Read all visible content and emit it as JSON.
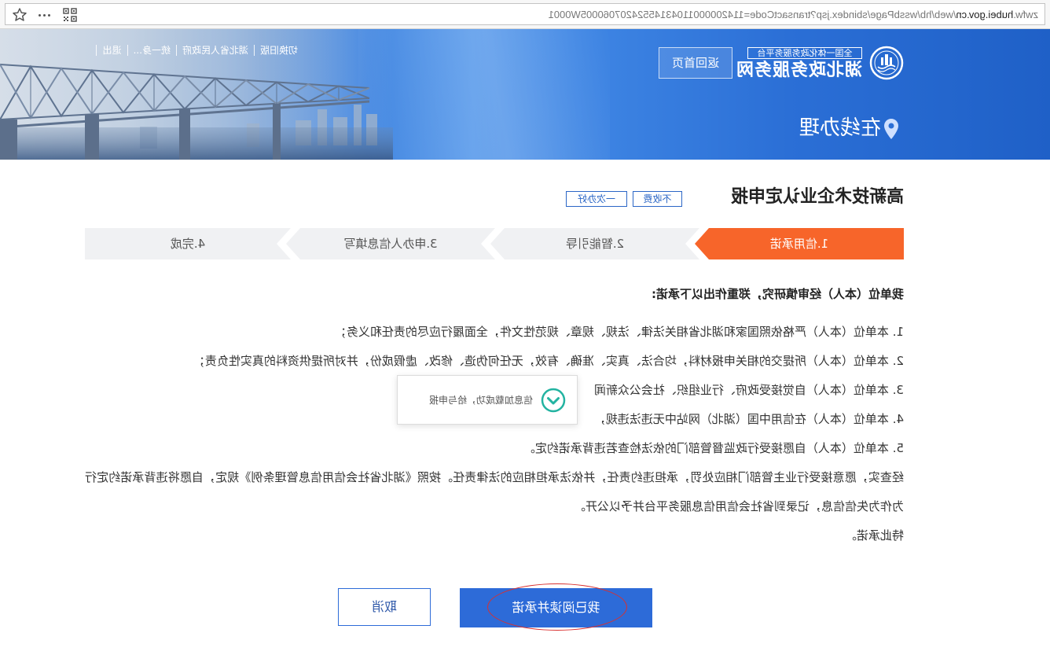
{
  "browser": {
    "url_prefix": "zwfw.",
    "url_domain": "hubei.gov.cn",
    "url_path": "/web/hb/wssbPage/sbindex.jsp?transactCode=11420000011043145524207060005W0001",
    "icons": {
      "qr": "qr-code-icon",
      "more": "more-icon",
      "star": "star-icon"
    }
  },
  "header": {
    "logo_subtitle": "全国一体化政务服务平台",
    "logo_title": "湖北政务服务网",
    "home_button": "返回首页",
    "top_links": [
      "切换旧版",
      "湖北省人民政府",
      "统一身...",
      "退出"
    ],
    "section_title": "在线办理",
    "icons": {
      "emblem": "emblem-icon",
      "location": "location-pin-icon"
    }
  },
  "service": {
    "title": "高新技术企业认定申报",
    "tags": [
      "不收费",
      "一次办好"
    ]
  },
  "steps": [
    {
      "label": "1.信用承诺",
      "active": true
    },
    {
      "label": "2.智能引导",
      "active": false
    },
    {
      "label": "3.申办人信息填写",
      "active": false
    },
    {
      "label": "4.完成",
      "active": false
    }
  ],
  "promise": {
    "heading": "我单位（本人）经审慎研究，郑重作出以下承诺:",
    "items": [
      "1. 本单位（本人）严格依照国家和湖北省相关法律、法规、规章、规范性文件，全面履行应尽的责任和义务；",
      "2. 本单位（本人）所提交的相关申报材料，均合法、真实、准确、有效，无任何伪造、修改、虚假成份，并对所提供资料的真实性负责；",
      "3. 本单位（本人）自觉接受政府、行业组织、社会公众新闻",
      "4. 本单位（本人）在信用中国（湖北）网站中无违法违规，",
      "5. 本单位（本人）自愿接受行政监督管部门的依法检查若违背承诺约定。"
    ],
    "paragraph": "经查实，愿意接受行业主管部门相应处罚，承担违约责任，并依法承担相应的法律责任。按照《湖北省社会信用信息管理条例》规定，自愿将违背承诺约定行为作为失信信息，记录到省社会信用信息服务平台并予以公开。",
    "closing": "特此承诺。"
  },
  "toast": {
    "message": "信息加载成功，给与申报",
    "icon": "check-circle-icon"
  },
  "actions": {
    "confirm": "我已阅读并承诺",
    "cancel": "取消"
  },
  "colors": {
    "header_blue": "#2b6fd6",
    "active_step": "#f7652a",
    "primary_button": "#2d6bd8",
    "toast_icon": "#23b3a1",
    "annotation": "#d9302f"
  }
}
